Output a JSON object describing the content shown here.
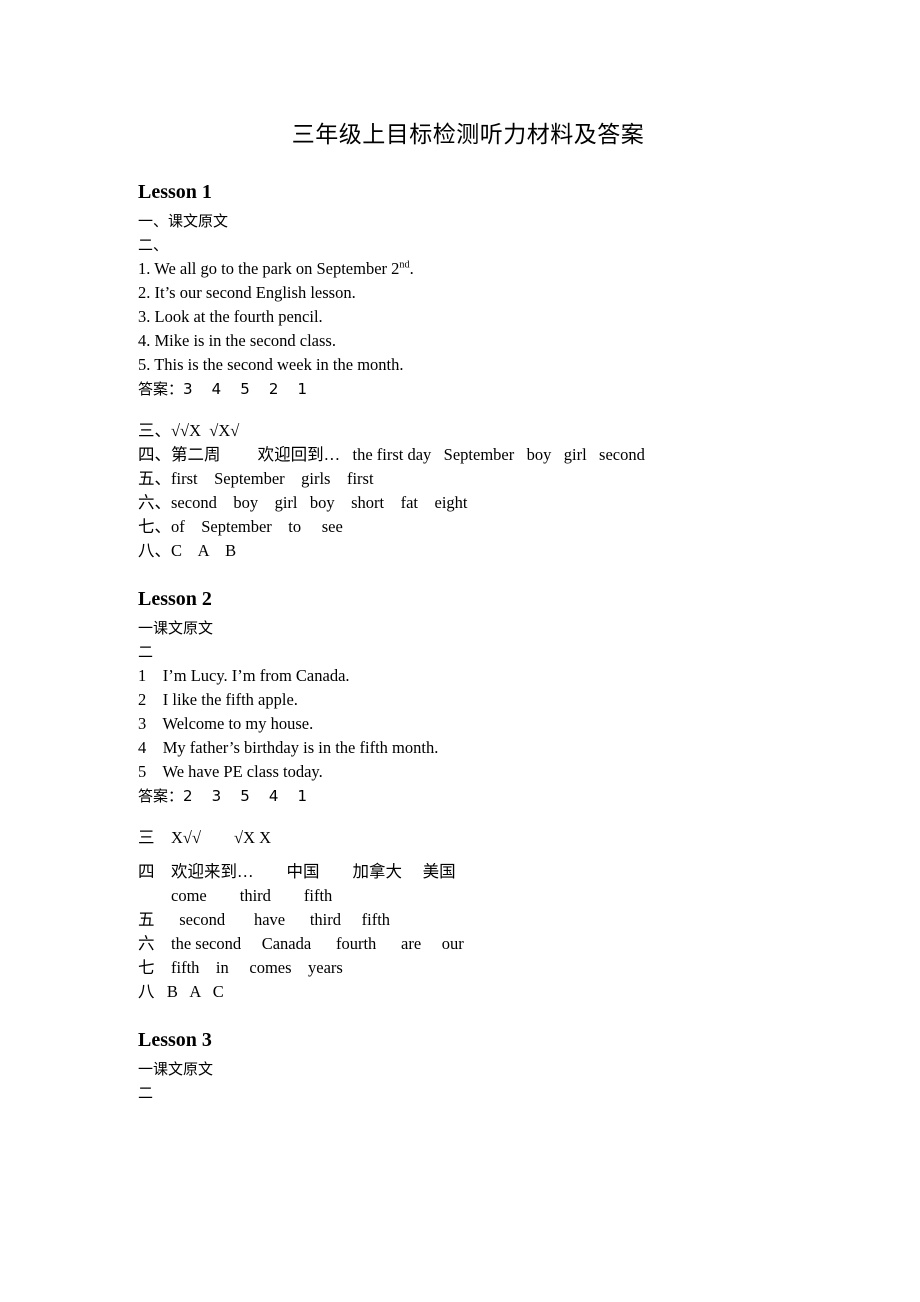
{
  "document": {
    "title": "三年级上目标检测听力材料及答案"
  },
  "lessons": [
    {
      "heading": "Lesson 1",
      "section_one": "一、课文原文",
      "section_two_label": "二、",
      "sentences": [
        "1. We all go to the park on September 2",
        "2. It’s our second English lesson.",
        "3. Look at the fourth pencil.",
        "4. Mike is in the second class.",
        "5. This is the second week in the month."
      ],
      "sentence1_sup": "nd",
      "sentence1_tail": ".",
      "answer_line": "答案：3    4    5    2    1",
      "sections": [
        "三、√√X  √X√",
        "四、第二周         欢迎回到…   the first day   September   boy   girl   second",
        "五、first    September    girls    first",
        "六、second    boy    girl   boy    short    fat    eight",
        "七、of    September    to     see",
        "八、C    A    B"
      ]
    },
    {
      "heading": "Lesson 2",
      "section_one": "一课文原文",
      "section_two_label": "二",
      "sentences": [
        "1    I’m Lucy. I’m from Canada.",
        "2    I like the fifth apple.",
        "3    Welcome to my house.",
        "4    My father’s birthday is in the fifth month.",
        "5    We have PE class today."
      ],
      "answer_line": "答案：2    3    5    4    1",
      "sections": [
        "三    X√√        √X X",
        "四    欢迎来到…        中国        加拿大     美国",
        "        come        third        fifth",
        "五      second       have      third     fifth",
        "六    the second     Canada      fourth      are     our",
        "七    fifth    in     comes    years",
        "八   B   A   C"
      ]
    },
    {
      "heading": "Lesson 3",
      "section_one": "一课文原文",
      "section_two_label": "二",
      "sentences": [],
      "answer_line": "",
      "sections": []
    }
  ]
}
